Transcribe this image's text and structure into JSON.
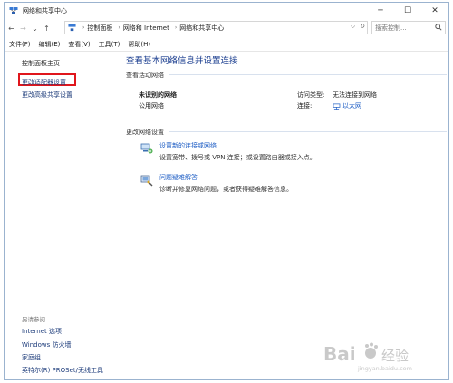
{
  "window": {
    "title": "网络和共享中心",
    "controls": {
      "minimize": "─",
      "maximize": "☐",
      "close": "✕"
    }
  },
  "address": {
    "back": "←",
    "forward": "→",
    "up": "↑",
    "crumbs": [
      "控制面板",
      "网络和 Internet",
      "网络和共享中心"
    ],
    "dropdown": "⌵",
    "refresh": "↻",
    "search_placeholder": "搜索控制...",
    "search_icon": "search-icon"
  },
  "menu": {
    "items": [
      "文件(F)",
      "编辑(E)",
      "查看(V)",
      "工具(T)",
      "帮助(H)"
    ]
  },
  "sidebar": {
    "home": "控制面板主页",
    "adapter": "更改适配器设置",
    "sharing": "更改高级共享设置",
    "see_also": "另请参阅",
    "links": [
      "Internet 选项",
      "Windows 防火墙",
      "家庭组",
      "英特尔(R) PROSet/无线工具"
    ]
  },
  "main": {
    "title": "查看基本网络信息并设置连接",
    "active_header": "查看活动网络",
    "network_name": "未识别的网络",
    "network_category": "公用网络",
    "access_label": "访问类型:",
    "access_value": "无法连接到网络",
    "conn_label": "连接:",
    "conn_value": "以太网",
    "change_header": "更改网络设置",
    "task1_link": "设置新的连接或网络",
    "task1_desc": "设置宽带、拨号或 VPN 连接；或设置路由器或接入点。",
    "task2_link": "问题疑难解答",
    "task2_desc": "诊断并修复网络问题，或者获得疑难解答信息。"
  },
  "watermark": {
    "brand": "Bai",
    "brand_suffix": "经验",
    "url": "jingyan.baidu.com"
  },
  "colors": {
    "link": "#1c5cc4",
    "title": "#1a3d8f",
    "highlight": "#e0161c"
  }
}
